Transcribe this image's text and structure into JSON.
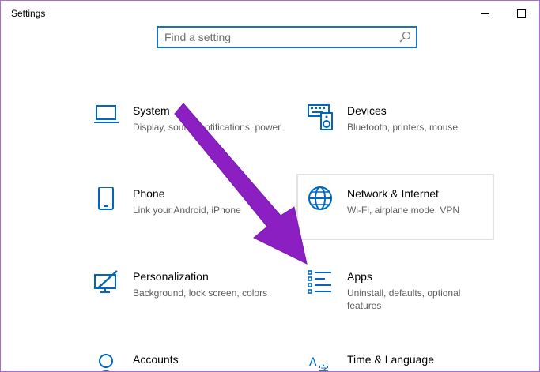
{
  "window": {
    "title": "Settings"
  },
  "search": {
    "placeholder": "Find a setting",
    "value": ""
  },
  "tiles": [
    {
      "name": "System",
      "desc": "Display, sound, notifications, power",
      "icon": "monitor-icon"
    },
    {
      "name": "Devices",
      "desc": "Bluetooth, printers, mouse",
      "icon": "keyboard-speaker-icon"
    },
    {
      "name": "Phone",
      "desc": "Link your Android, iPhone",
      "icon": "phone-icon"
    },
    {
      "name": "Network & Internet",
      "desc": "Wi-Fi, airplane mode, VPN",
      "icon": "globe-icon"
    },
    {
      "name": "Personalization",
      "desc": "Background, lock screen, colors",
      "icon": "paint-display-icon"
    },
    {
      "name": "Apps",
      "desc": "Uninstall, defaults, optional features",
      "icon": "apps-list-icon"
    },
    {
      "name": "Accounts",
      "desc": "",
      "icon": "person-icon"
    },
    {
      "name": "Time & Language",
      "desc": "",
      "icon": "time-language-icon"
    }
  ],
  "colors": {
    "accent": "#0067c0",
    "annotation_arrow": "#8b1fc2",
    "search_border": "#1a73c2"
  }
}
